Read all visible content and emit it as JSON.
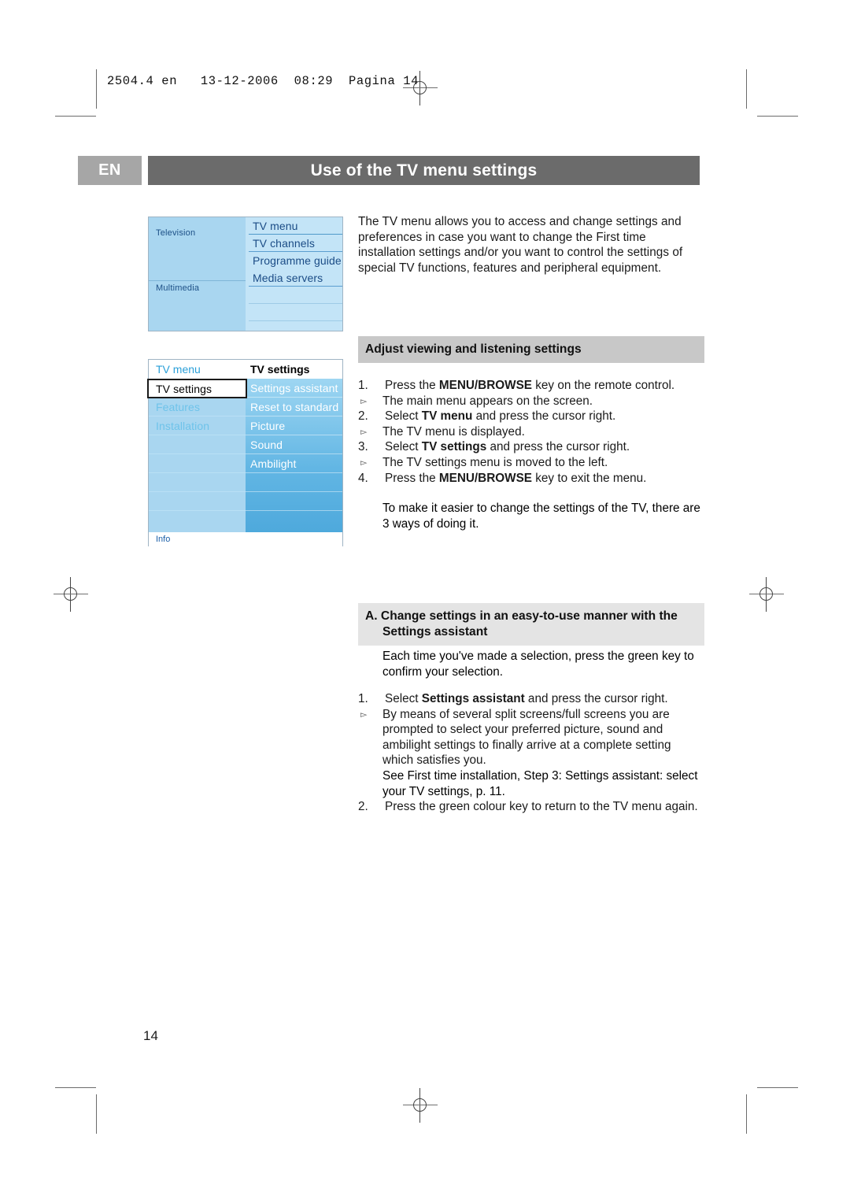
{
  "imprint": {
    "text": "2504.4 en   13-12-2006  08:29  Pagina 14"
  },
  "header": {
    "language_code": "EN",
    "title": "Use of the TV menu settings"
  },
  "menu_main": {
    "categories": [
      "Television",
      "Multimedia"
    ],
    "items": [
      "TV menu",
      "TV channels",
      "Programme guide",
      "Media servers"
    ]
  },
  "menu_settings": {
    "left_header": "TV menu",
    "right_header": "TV settings",
    "left_items": [
      "TV settings",
      "Features",
      "Installation"
    ],
    "selected_left_item": "TV settings",
    "right_items": [
      "Settings assistant",
      "Reset to standard",
      "Picture",
      "Sound",
      "Ambilight"
    ],
    "footer": "Info"
  },
  "intro": {
    "paragraph": "The TV menu allows you to access and change settings and preferences in case you want to change the First time installation settings and/or you want to control the settings of special TV functions, features and peripheral equipment."
  },
  "section_adjust": {
    "heading": "Adjust viewing and listening settings",
    "steps": [
      {
        "num": "1.",
        "pre": "Press the ",
        "bold": "MENU/BROWSE",
        "post": " key on the remote control.",
        "sub": "The main menu appears on the screen."
      },
      {
        "num": "2.",
        "pre": "Select ",
        "bold": "TV menu",
        "post": " and press the cursor right.",
        "sub": "The TV menu is displayed."
      },
      {
        "num": "3.",
        "pre": "Select ",
        "bold": "TV settings",
        "post": " and press the cursor right.",
        "sub": "The TV settings menu is moved to the left."
      },
      {
        "num": "4.",
        "pre": "Press the ",
        "bold": "MENU/BROWSE",
        "post": " key to exit the menu.",
        "sub": ""
      }
    ],
    "closing": "To make it easier to change the settings of the TV, there are 3 ways of doing it."
  },
  "section_assistant": {
    "heading_line1": "A. Change settings in an easy-to-use manner with the",
    "heading_line2": "Settings assistant",
    "intro": "Each time you've made a selection, press the green key to confirm your selection.",
    "steps": [
      {
        "num": "1.",
        "pre": "Select ",
        "bold": "Settings assistant",
        "post": " and press the cursor right.",
        "sub": "By means of several split screens/full screens you are prompted to select your preferred picture, sound and ambilight settings to finally arrive at a complete setting which satisfies you.",
        "cont": "See First time installation, Step 3: Settings assistant: select your TV settings, p. 11."
      },
      {
        "num": "2.",
        "pre": "Press the green colour key to return to the TV menu again.",
        "bold": "",
        "post": "",
        "sub": ""
      }
    ]
  },
  "footer": {
    "page_number": "14"
  },
  "colors": {
    "band_dark": "#c8c8c8",
    "band_light": "#e4e4e4",
    "title_bar": "#6b6b6b",
    "en_box": "#a6a6a6",
    "menu_light_blue": "#a9d6f0",
    "menu_pale_blue": "#c3e4f7",
    "menu_text_blue": "#1b4c86"
  }
}
